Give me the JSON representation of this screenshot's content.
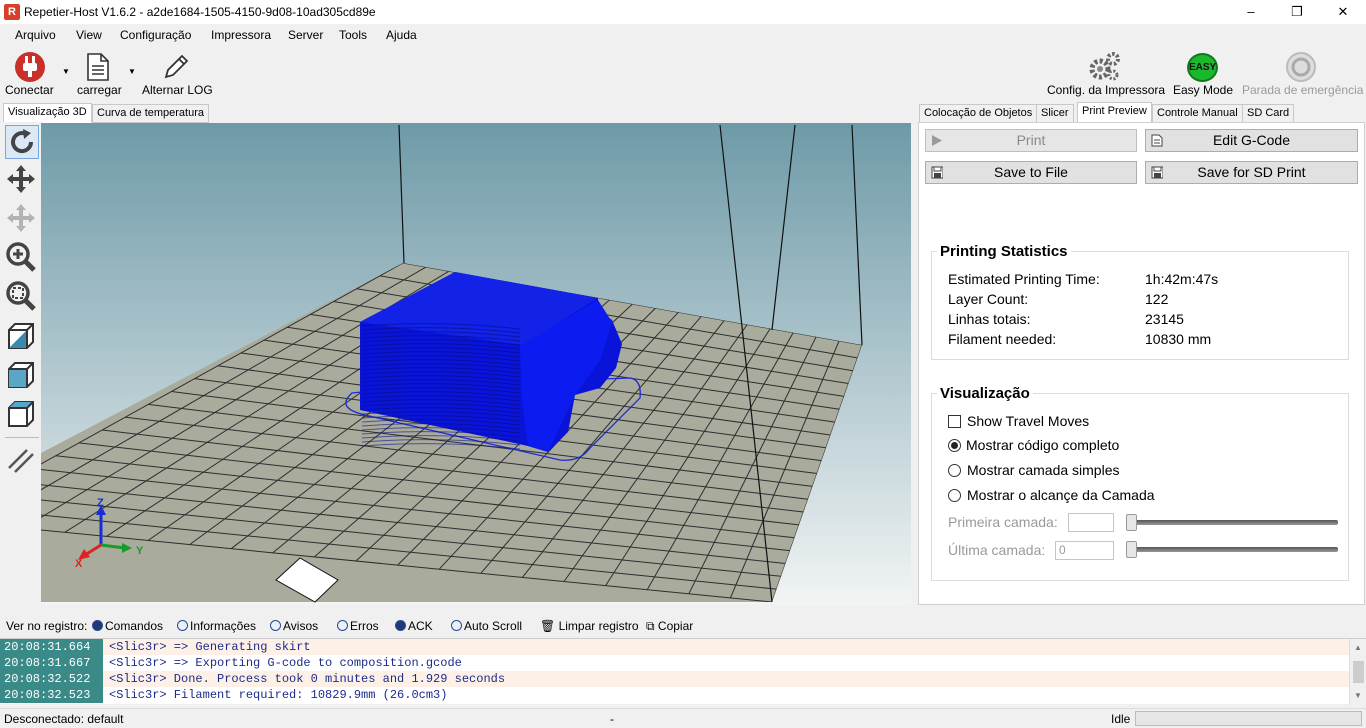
{
  "window": {
    "title": "Repetier-Host V1.6.2 - a2de1684-1505-4150-9d08-10ad305cd89e",
    "app_icon": "R",
    "minimize_icon": "–",
    "maximize_icon": "❐",
    "close_icon": "✕"
  },
  "menu": [
    "Arquivo",
    "View",
    "Configuração",
    "Impressora",
    "Server",
    "Tools",
    "Ajuda"
  ],
  "toolbar": {
    "connect": "Conectar",
    "load": "carregar",
    "toggle_log": "Alternar LOG",
    "printer_config": "Config. da Impressora",
    "easy_mode": "Easy Mode",
    "easy_badge": "EASY",
    "emergency_stop": "Parada de emergência"
  },
  "left_tabs": [
    "Visualização 3D",
    "Curva de temperatura"
  ],
  "right_tabs": [
    "Colocação de Objetos",
    "Slicer",
    "Print Preview",
    "Controle Manual",
    "SD Card"
  ],
  "preview": {
    "print_button": "Print",
    "edit_gcode_button": "Edit G-Code",
    "save_file_button": "Save to File",
    "save_sd_button": "Save for SD Print"
  },
  "stats": {
    "title": "Printing Statistics",
    "rows": [
      {
        "label": "Estimated Printing Time:",
        "value": "1h:42m:47s"
      },
      {
        "label": "Layer Count:",
        "value": "122"
      },
      {
        "label": "Linhas totais:",
        "value": "23145"
      },
      {
        "label": "Filament needed:",
        "value": "10830 mm"
      }
    ]
  },
  "visual": {
    "title": "Visualização",
    "show_travel": "Show Travel Moves",
    "show_travel_checked": false,
    "options": [
      "Mostrar código completo",
      "Mostrar camada simples",
      "Mostrar o alcançe da Camada"
    ],
    "selected_option": 0,
    "first_layer_label": "Primeira camada:",
    "first_layer_value": "",
    "last_layer_label": "Última camada:",
    "last_layer_value": "0"
  },
  "log_toolbar": {
    "label": "Ver no registro:",
    "filters": [
      "Comandos",
      "Informações",
      "Avisos",
      "Erros",
      "ACK",
      "Auto Scroll"
    ],
    "filters_on": [
      true,
      false,
      false,
      false,
      true,
      false
    ],
    "clear": "Limpar registro",
    "copy": "Copiar"
  },
  "log": [
    {
      "time": "20:08:31.664",
      "msg": "<Slic3r> => Generating skirt"
    },
    {
      "time": "20:08:31.667",
      "msg": "<Slic3r> => Exporting G-code to composition.gcode"
    },
    {
      "time": "20:08:32.522",
      "msg": "<Slic3r> Done. Process took 0 minutes and 1.929 seconds"
    },
    {
      "time": "20:08:32.523",
      "msg": "<Slic3r> Filament required: 10829.9mm (26.0cm3)"
    }
  ],
  "status": {
    "connection": "Desconectado: default",
    "middle": "-",
    "state": "Idle"
  },
  "axes": {
    "x": "X",
    "y": "Y",
    "z": "Z"
  },
  "colors": {
    "model": "#0a14d8",
    "bed": "#a9ab9c",
    "sky_top": "#6e9aa8",
    "log_time_bg": "#3a8a88"
  }
}
